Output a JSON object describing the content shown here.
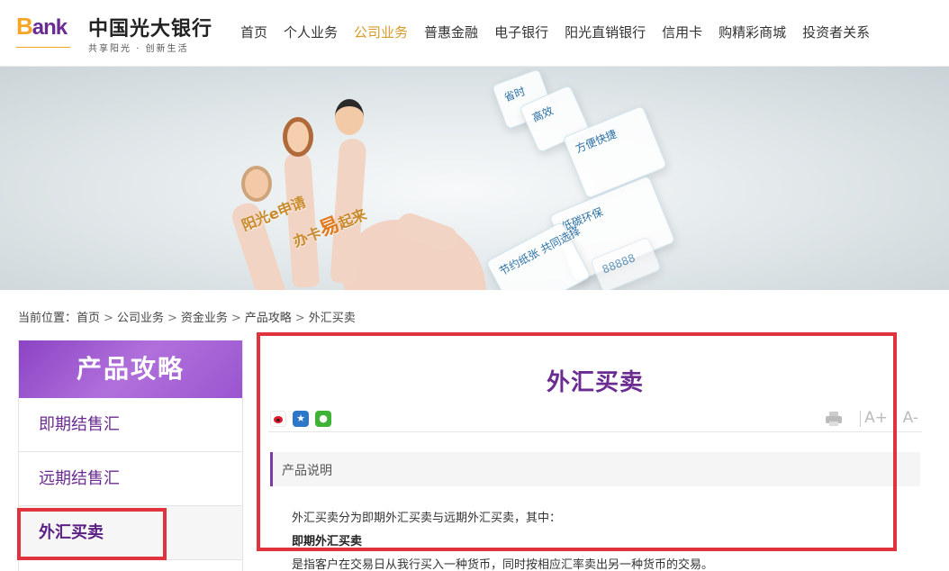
{
  "header": {
    "logo_bank": "Bank",
    "logo_bank_initial": "B",
    "logo_bank_rest": "ank",
    "bank_name": "中国光大银行",
    "slogan": "共享阳光 · 创新生活",
    "nav": [
      {
        "label": "首页",
        "active": false
      },
      {
        "label": "个人业务",
        "active": false
      },
      {
        "label": "公司业务",
        "active": true
      },
      {
        "label": "普惠金融",
        "active": false
      },
      {
        "label": "电子银行",
        "active": false
      },
      {
        "label": "阳光直销银行",
        "active": false
      },
      {
        "label": "信用卡",
        "active": false
      },
      {
        "label": "购精彩商城",
        "active": false
      },
      {
        "label": "投资者关系",
        "active": false
      }
    ]
  },
  "banner": {
    "tag_line1": "阳光e申请",
    "tag_line2_a": "办卡",
    "tag_line2_b": "易",
    "tag_line2_c": "起来",
    "cards": [
      "省时",
      "高效",
      "方便快捷",
      "低碳环保",
      "节约纸张 共同选择",
      "88888"
    ]
  },
  "breadcrumb": {
    "prefix": "当前位置：",
    "items": [
      "首页",
      "公司业务",
      "资金业务",
      "产品攻略",
      "外汇买卖"
    ],
    "separator": ">"
  },
  "sidebar": {
    "title": "产品攻略",
    "items": [
      {
        "label": "即期结售汇",
        "active": false
      },
      {
        "label": "远期结售汇",
        "active": false
      },
      {
        "label": "外汇买卖",
        "active": true
      }
    ]
  },
  "main": {
    "title": "外汇买卖",
    "section_label": "产品说明",
    "paragraphs": [
      "外汇买卖分为即期外汇买卖与远期外汇买卖，其中：",
      "即期外汇买卖",
      "是指客户在交易日从我行买入一种货币，同时按相应汇率卖出另一种货币的交易。"
    ],
    "font_up_label": "A+",
    "font_down_label": "A-"
  },
  "colors": {
    "brand_purple": "#6a2c91",
    "nav_active": "#d89b2a",
    "highlight_red": "#e0333d"
  },
  "icons": [
    "weibo-icon",
    "qzone-icon",
    "wechat-icon",
    "print-icon"
  ]
}
